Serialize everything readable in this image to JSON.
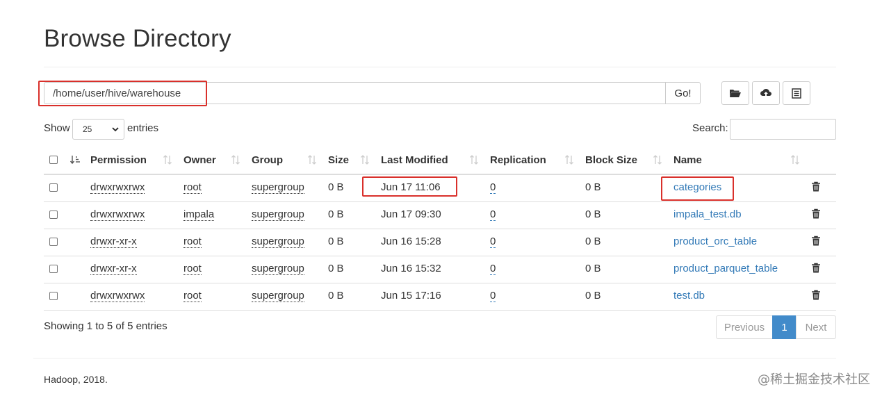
{
  "page": {
    "title": "Browse Directory",
    "footer": "Hadoop, 2018.",
    "watermark": "@稀土掘金技术社区"
  },
  "toolbar": {
    "path_value": "/home/user/hive/warehouse",
    "go_label": "Go!",
    "icons": [
      "folder-open-icon",
      "upload-cloud-icon",
      "list-icon"
    ]
  },
  "table_controls": {
    "show_label": "Show",
    "page_size": "25",
    "entries_label": "entries",
    "search_label": "Search:",
    "search_value": ""
  },
  "columns": [
    "Permission",
    "Owner",
    "Group",
    "Size",
    "Last Modified",
    "Replication",
    "Block Size",
    "Name"
  ],
  "rows": [
    {
      "permission": "drwxrwxrwx",
      "owner": "root",
      "group": "supergroup",
      "size": "0 B",
      "modified": "Jun 17 11:06",
      "replication": "0",
      "block_size": "0 B",
      "name": "categories"
    },
    {
      "permission": "drwxrwxrwx",
      "owner": "impala",
      "group": "supergroup",
      "size": "0 B",
      "modified": "Jun 17 09:30",
      "replication": "0",
      "block_size": "0 B",
      "name": "impala_test.db"
    },
    {
      "permission": "drwxr-xr-x",
      "owner": "root",
      "group": "supergroup",
      "size": "0 B",
      "modified": "Jun 16 15:28",
      "replication": "0",
      "block_size": "0 B",
      "name": "product_orc_table"
    },
    {
      "permission": "drwxr-xr-x",
      "owner": "root",
      "group": "supergroup",
      "size": "0 B",
      "modified": "Jun 16 15:32",
      "replication": "0",
      "block_size": "0 B",
      "name": "product_parquet_table"
    },
    {
      "permission": "drwxrwxrwx",
      "owner": "root",
      "group": "supergroup",
      "size": "0 B",
      "modified": "Jun 15 17:16",
      "replication": "0",
      "block_size": "0 B",
      "name": "test.db"
    }
  ],
  "pagination": {
    "info": "Showing 1 to 5 of 5 entries",
    "previous": "Previous",
    "current": "1",
    "next": "Next"
  },
  "colors": {
    "link": "#337ab7",
    "highlight": "#d9302b",
    "active_page": "#428bca"
  }
}
